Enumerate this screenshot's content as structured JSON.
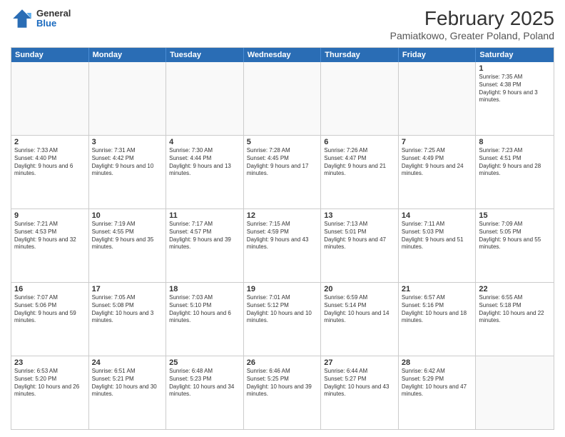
{
  "header": {
    "logo": {
      "general": "General",
      "blue": "Blue"
    },
    "title": "February 2025",
    "subtitle": "Pamiatkowo, Greater Poland, Poland"
  },
  "weekdays": [
    "Sunday",
    "Monday",
    "Tuesday",
    "Wednesday",
    "Thursday",
    "Friday",
    "Saturday"
  ],
  "rows": [
    [
      {
        "day": "",
        "text": ""
      },
      {
        "day": "",
        "text": ""
      },
      {
        "day": "",
        "text": ""
      },
      {
        "day": "",
        "text": ""
      },
      {
        "day": "",
        "text": ""
      },
      {
        "day": "",
        "text": ""
      },
      {
        "day": "1",
        "text": "Sunrise: 7:35 AM\nSunset: 4:38 PM\nDaylight: 9 hours and 3 minutes."
      }
    ],
    [
      {
        "day": "2",
        "text": "Sunrise: 7:33 AM\nSunset: 4:40 PM\nDaylight: 9 hours and 6 minutes."
      },
      {
        "day": "3",
        "text": "Sunrise: 7:31 AM\nSunset: 4:42 PM\nDaylight: 9 hours and 10 minutes."
      },
      {
        "day": "4",
        "text": "Sunrise: 7:30 AM\nSunset: 4:44 PM\nDaylight: 9 hours and 13 minutes."
      },
      {
        "day": "5",
        "text": "Sunrise: 7:28 AM\nSunset: 4:45 PM\nDaylight: 9 hours and 17 minutes."
      },
      {
        "day": "6",
        "text": "Sunrise: 7:26 AM\nSunset: 4:47 PM\nDaylight: 9 hours and 21 minutes."
      },
      {
        "day": "7",
        "text": "Sunrise: 7:25 AM\nSunset: 4:49 PM\nDaylight: 9 hours and 24 minutes."
      },
      {
        "day": "8",
        "text": "Sunrise: 7:23 AM\nSunset: 4:51 PM\nDaylight: 9 hours and 28 minutes."
      }
    ],
    [
      {
        "day": "9",
        "text": "Sunrise: 7:21 AM\nSunset: 4:53 PM\nDaylight: 9 hours and 32 minutes."
      },
      {
        "day": "10",
        "text": "Sunrise: 7:19 AM\nSunset: 4:55 PM\nDaylight: 9 hours and 35 minutes."
      },
      {
        "day": "11",
        "text": "Sunrise: 7:17 AM\nSunset: 4:57 PM\nDaylight: 9 hours and 39 minutes."
      },
      {
        "day": "12",
        "text": "Sunrise: 7:15 AM\nSunset: 4:59 PM\nDaylight: 9 hours and 43 minutes."
      },
      {
        "day": "13",
        "text": "Sunrise: 7:13 AM\nSunset: 5:01 PM\nDaylight: 9 hours and 47 minutes."
      },
      {
        "day": "14",
        "text": "Sunrise: 7:11 AM\nSunset: 5:03 PM\nDaylight: 9 hours and 51 minutes."
      },
      {
        "day": "15",
        "text": "Sunrise: 7:09 AM\nSunset: 5:05 PM\nDaylight: 9 hours and 55 minutes."
      }
    ],
    [
      {
        "day": "16",
        "text": "Sunrise: 7:07 AM\nSunset: 5:06 PM\nDaylight: 9 hours and 59 minutes."
      },
      {
        "day": "17",
        "text": "Sunrise: 7:05 AM\nSunset: 5:08 PM\nDaylight: 10 hours and 3 minutes."
      },
      {
        "day": "18",
        "text": "Sunrise: 7:03 AM\nSunset: 5:10 PM\nDaylight: 10 hours and 6 minutes."
      },
      {
        "day": "19",
        "text": "Sunrise: 7:01 AM\nSunset: 5:12 PM\nDaylight: 10 hours and 10 minutes."
      },
      {
        "day": "20",
        "text": "Sunrise: 6:59 AM\nSunset: 5:14 PM\nDaylight: 10 hours and 14 minutes."
      },
      {
        "day": "21",
        "text": "Sunrise: 6:57 AM\nSunset: 5:16 PM\nDaylight: 10 hours and 18 minutes."
      },
      {
        "day": "22",
        "text": "Sunrise: 6:55 AM\nSunset: 5:18 PM\nDaylight: 10 hours and 22 minutes."
      }
    ],
    [
      {
        "day": "23",
        "text": "Sunrise: 6:53 AM\nSunset: 5:20 PM\nDaylight: 10 hours and 26 minutes."
      },
      {
        "day": "24",
        "text": "Sunrise: 6:51 AM\nSunset: 5:21 PM\nDaylight: 10 hours and 30 minutes."
      },
      {
        "day": "25",
        "text": "Sunrise: 6:48 AM\nSunset: 5:23 PM\nDaylight: 10 hours and 34 minutes."
      },
      {
        "day": "26",
        "text": "Sunrise: 6:46 AM\nSunset: 5:25 PM\nDaylight: 10 hours and 39 minutes."
      },
      {
        "day": "27",
        "text": "Sunrise: 6:44 AM\nSunset: 5:27 PM\nDaylight: 10 hours and 43 minutes."
      },
      {
        "day": "28",
        "text": "Sunrise: 6:42 AM\nSunset: 5:29 PM\nDaylight: 10 hours and 47 minutes."
      },
      {
        "day": "",
        "text": ""
      }
    ]
  ]
}
